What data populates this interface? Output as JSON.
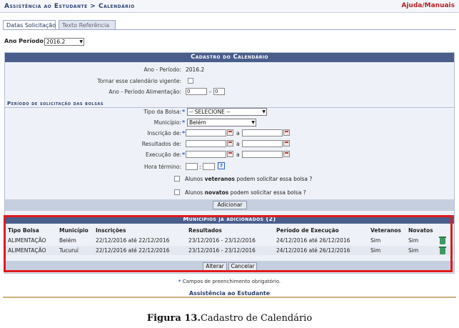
{
  "header": {
    "title": "Assistência ao Estudante > Calendário",
    "help_link": "Ajuda/Manuais"
  },
  "tabs": [
    {
      "label": "Datas Solicitação"
    },
    {
      "label": "Texto Referência"
    }
  ],
  "filter": {
    "label": "Ano Período:",
    "value": "2016.2"
  },
  "form": {
    "caption": "Cadastro do Calendário",
    "ano_periodo_label": "Ano - Período:",
    "ano_periodo_value": "2016.2",
    "vigente_label": "Tornar esse calendário vigente:",
    "alimentacao_label": "Ano - Período Alimentação:",
    "alimentacao_ano": "0",
    "alimentacao_sep": "-",
    "alimentacao_periodo": "0",
    "section_title": "Período de solicitação das bolsas",
    "tipo_bolsa_label": "Tipo da Bolsa:",
    "tipo_bolsa_value": "-- SELECIONE --",
    "municipio_label": "Município:",
    "municipio_value": "Belém",
    "inscricao_label": "Inscrição de:",
    "resultados_label": "Resultados de:",
    "execucao_label": "Execução de:",
    "range_sep": "a",
    "hora_label": "Hora término:",
    "time_sep": ":",
    "help_glyph": "?",
    "veteranos_pre": "Alunos ",
    "veteranos_bold": "veteranos",
    "veteranos_post": " podem solicitar essa bolsa ?",
    "novatos_pre": "Alunos ",
    "novatos_bold": "novatos",
    "novatos_post": " podem solicitar essa bolsa ?",
    "add_button": "Adicionar",
    "required_mark": "*"
  },
  "municipios": {
    "caption": "Municípios já adicionados (2)",
    "columns": [
      "Tipo Bolsa",
      "Município",
      "Inscrições",
      "Resultados",
      "Período de Execução",
      "Veteranos",
      "Novatos"
    ],
    "rows": [
      {
        "tipo": "ALIMENTAÇÃO",
        "municipio": "Belém",
        "inscricoes": "22/12/2016 até 22/12/2016",
        "resultados": "23/12/2016 - 23/12/2016",
        "execucao": "24/12/2016 até 26/12/2016",
        "veteranos": "Sim",
        "novatos": "Sim"
      },
      {
        "tipo": "ALIMENTAÇÃO",
        "municipio": "Tucuruí",
        "inscricoes": "22/12/2016 até 22/12/2016",
        "resultados": "23/12/2016 - 23/12/2016",
        "execucao": "24/12/2016 até 26/12/2016",
        "veteranos": "Sim",
        "novatos": "Sim"
      }
    ]
  },
  "actions": {
    "alterar": "Alterar",
    "cancelar": "Cancelar"
  },
  "footer": {
    "required_note": " Campos de preenchimento obrigatório.",
    "link": "Assistência ao Estudante"
  },
  "figure_caption": {
    "bold": "Figura 13.",
    "text": "Cadastro de Calendário"
  },
  "colors": {
    "caption_bg": "#4a5e8c",
    "highlight": "#e01b1b",
    "help_link": "#b22222"
  }
}
